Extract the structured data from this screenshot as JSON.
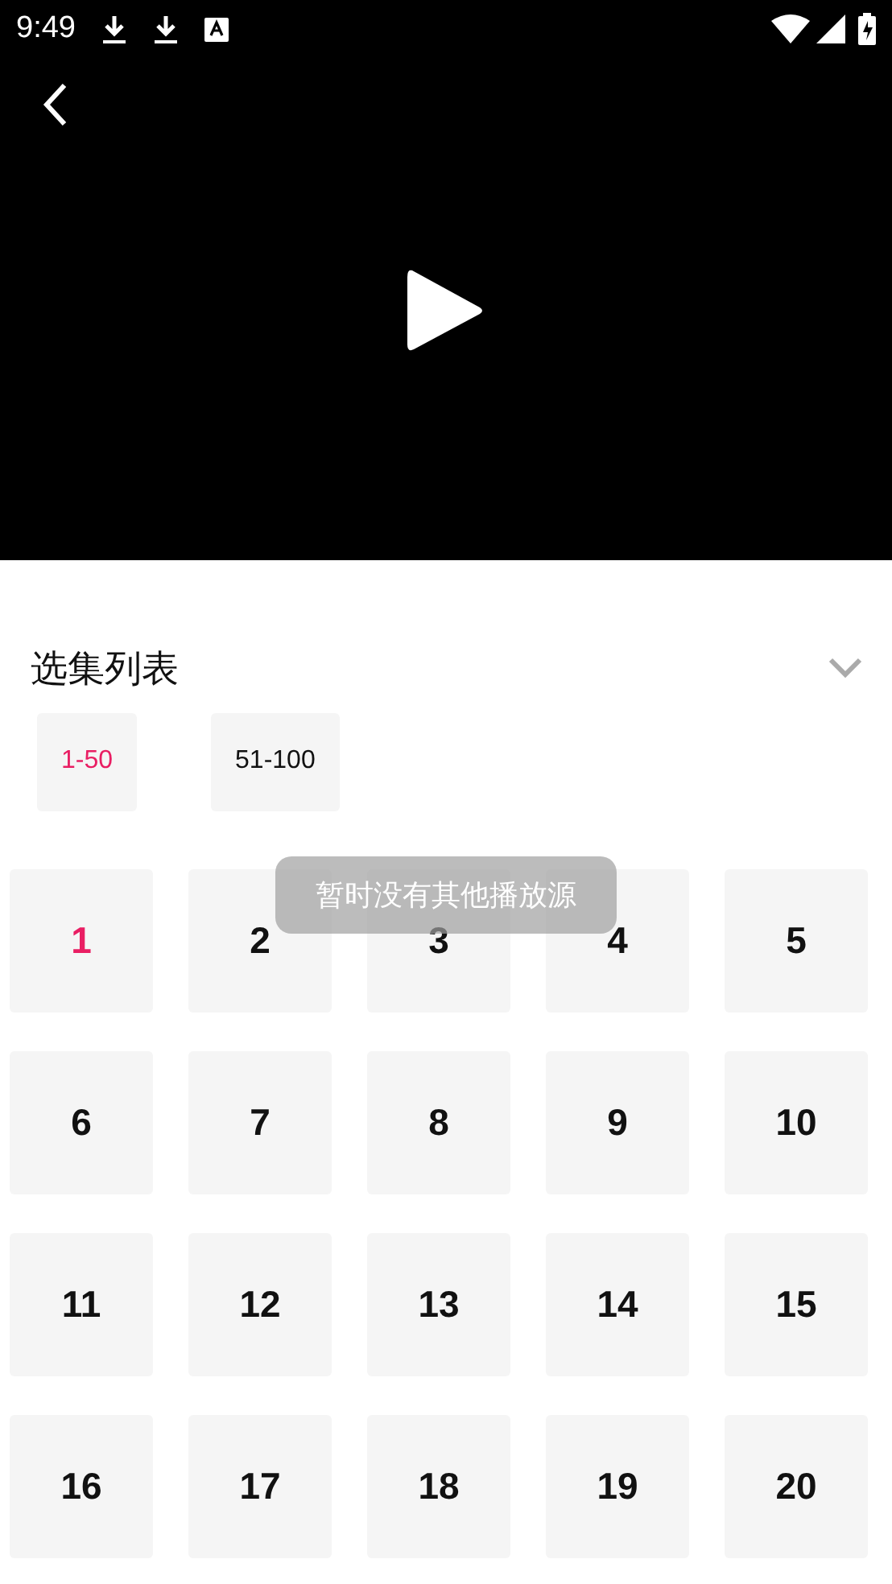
{
  "status_bar": {
    "time": "9:49"
  },
  "section": {
    "title": "选集列表",
    "expanded": true
  },
  "ranges": [
    {
      "label": "1-50",
      "selected": true
    },
    {
      "label": "51-100",
      "selected": false
    }
  ],
  "episodes": [
    {
      "label": "1",
      "selected": true
    },
    {
      "label": "2",
      "selected": false
    },
    {
      "label": "3",
      "selected": false
    },
    {
      "label": "4",
      "selected": false
    },
    {
      "label": "5",
      "selected": false
    },
    {
      "label": "6",
      "selected": false
    },
    {
      "label": "7",
      "selected": false
    },
    {
      "label": "8",
      "selected": false
    },
    {
      "label": "9",
      "selected": false
    },
    {
      "label": "10",
      "selected": false
    },
    {
      "label": "11",
      "selected": false
    },
    {
      "label": "12",
      "selected": false
    },
    {
      "label": "13",
      "selected": false
    },
    {
      "label": "14",
      "selected": false
    },
    {
      "label": "15",
      "selected": false
    },
    {
      "label": "16",
      "selected": false
    },
    {
      "label": "17",
      "selected": false
    },
    {
      "label": "18",
      "selected": false
    },
    {
      "label": "19",
      "selected": false
    },
    {
      "label": "20",
      "selected": false
    }
  ],
  "toast": "暂时没有其他播放源"
}
